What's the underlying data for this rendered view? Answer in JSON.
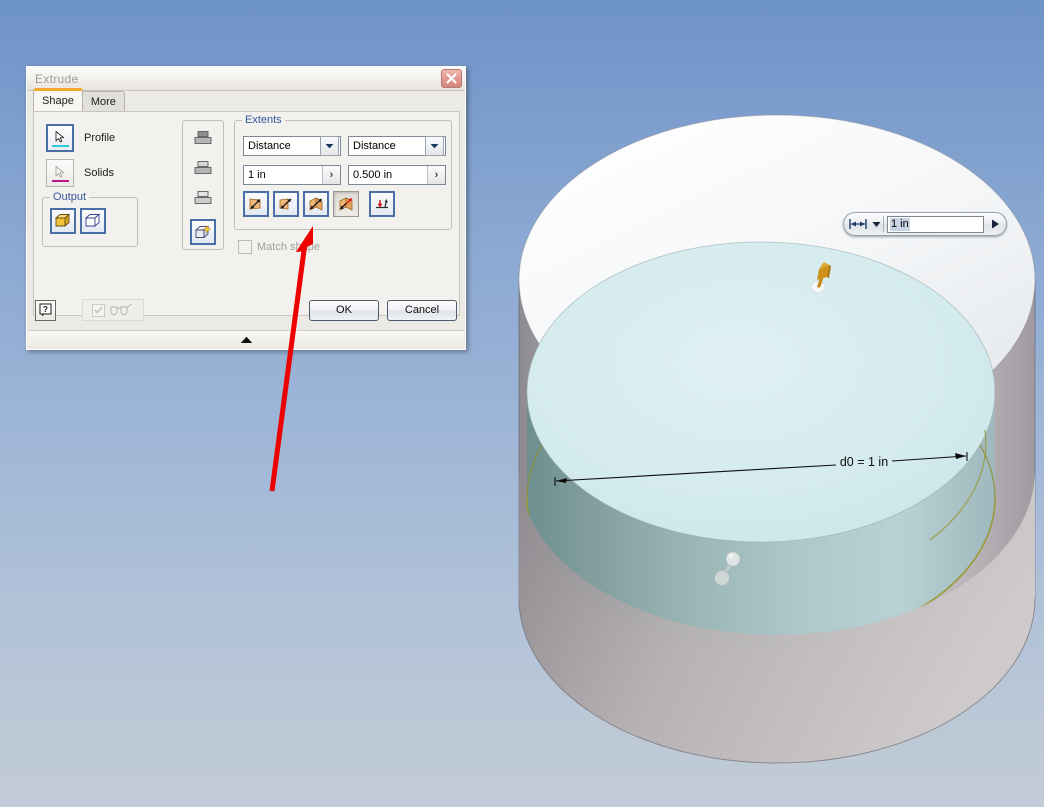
{
  "app": {
    "background_top_color": "#6e93c8",
    "background_bottom_color": "#c2ccd8"
  },
  "dialog": {
    "title": "Extrude",
    "close_label": "✕",
    "tabs": [
      {
        "label": "Shape",
        "active": true
      },
      {
        "label": "More",
        "active": false
      }
    ],
    "selection": [
      {
        "label": "Profile",
        "icon": "cursor-arrow-icon",
        "underline_color": "#30c8e0",
        "active": true
      },
      {
        "label": "Solids",
        "icon": "cursor-arrow-icon",
        "underline_color": "#b8188c",
        "active": false
      }
    ],
    "operations": {
      "items": [
        {
          "name": "join-operation",
          "icon": "join-icon"
        },
        {
          "name": "cut-operation",
          "icon": "cut-icon"
        },
        {
          "name": "intersect-operation",
          "icon": "intersect-icon"
        },
        {
          "name": "new-solid-operation",
          "icon": "new-solid-icon",
          "selected": true
        }
      ]
    },
    "extents": {
      "title": "Extents",
      "start": {
        "type_value": "Distance",
        "distance_value": "1 in",
        "spin_glyph": "›"
      },
      "end": {
        "type_value": "Distance",
        "distance_value": "0.500 in",
        "spin_glyph": "›"
      },
      "direction_buttons": [
        {
          "name": "direction-1-button",
          "label": "Direction 1",
          "state": "normal"
        },
        {
          "name": "direction-2-button",
          "label": "Direction 2",
          "state": "normal"
        },
        {
          "name": "direction-symmetric-button",
          "label": "Symmetric",
          "state": "normal"
        },
        {
          "name": "direction-asymmetric-button",
          "label": "Asymmetric",
          "state": "pressed",
          "highlight_color": "#ff0000"
        }
      ],
      "taper_button": {
        "name": "taper-angle-button",
        "label": "Taper"
      }
    },
    "output": {
      "title": "Output",
      "items": [
        {
          "name": "output-solid-button",
          "label": "Solid",
          "selected": true
        },
        {
          "name": "output-surface-button",
          "label": "Surface",
          "selected": false
        }
      ]
    },
    "match_shape": {
      "label": "Match shape",
      "checked": false,
      "enabled": false
    },
    "footer": {
      "help_label": "?",
      "preview_label": "Preview / Glasses",
      "preview_checked": true,
      "preview_enabled": false,
      "ok_label": "OK",
      "cancel_label": "Cancel"
    },
    "resize_grip_glyph": "▲"
  },
  "canvas": {
    "value_box": {
      "icon": "linear-dimension-icon",
      "caret": "▼",
      "value": "1 in",
      "go_glyph": "▶"
    },
    "dimension_annotation": {
      "label": "d0 = 1 in"
    },
    "manipulators": [
      {
        "name": "extrude-direction-handle",
        "color": "#cf9018"
      },
      {
        "name": "extrude-distance-handle",
        "color": "#d8dedd"
      }
    ],
    "model": {
      "preview_body_color": "#f3f5f7",
      "extrude_body_color": "#a8c6c6",
      "extrude_top_color": "#d8eef1",
      "edge_highlight_color": "#a0a03c"
    }
  },
  "annotation": {
    "arrow_color": "#ee0000",
    "target": "direction-asymmetric-button"
  }
}
